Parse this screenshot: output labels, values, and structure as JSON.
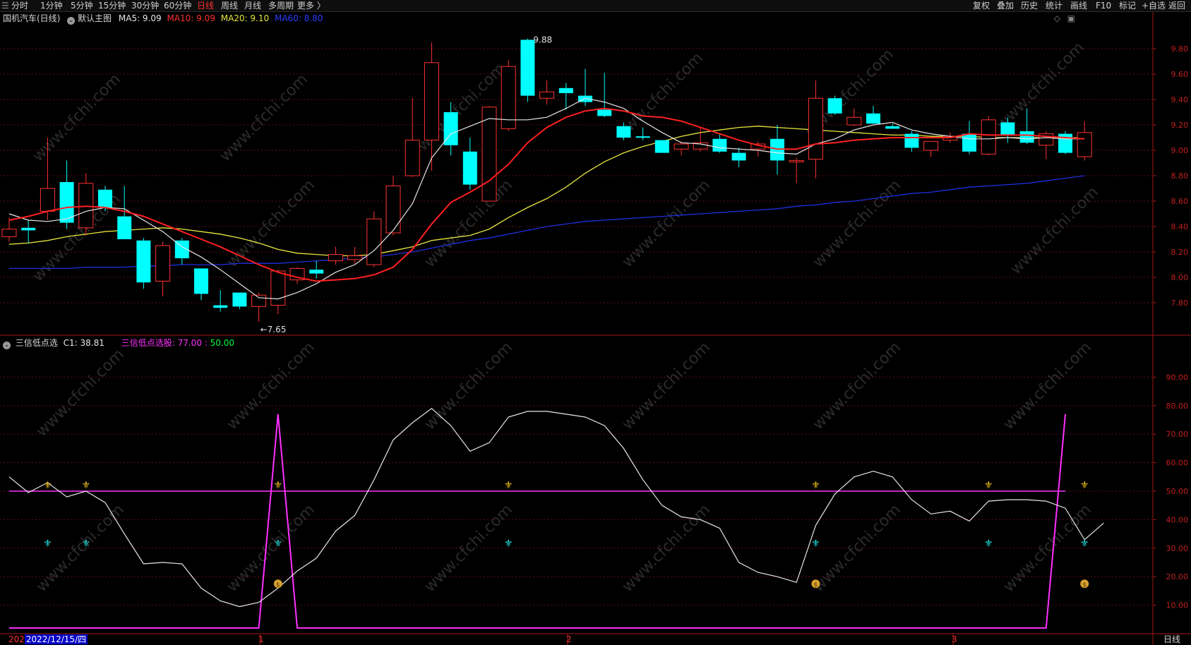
{
  "toolbar": {
    "left_items": [
      "分时",
      "1分钟",
      "5分钟",
      "15分钟",
      "30分钟",
      "60分钟",
      "日线",
      "周线",
      "月线",
      "多周期",
      "更多 〉"
    ],
    "active": "日线",
    "right_items": [
      "复权",
      "叠加",
      "历史",
      "统计",
      "画线",
      "F10",
      "标记",
      "+自选",
      "返回"
    ]
  },
  "main_legend": {
    "stock": "国机汽车(日线)",
    "template": "默认主图",
    "ma5": "MA5: 9.09",
    "ma10": "MA10: 9.09",
    "ma20": "MA20: 9.10",
    "ma60": "MA60: 8.80"
  },
  "sub_legend": {
    "name": "三信低点选",
    "c1": "C1: 38.81",
    "signal_name": "三信低点选股: ",
    "signal_v1": "77.00",
    "signal_sep": " : ",
    "signal_v2": "50.00"
  },
  "bottom": {
    "date_prefix": "202",
    "date_label": "2022/12/15/四",
    "month_1": "1",
    "month_2": "2",
    "month_3": "3",
    "period": "日线"
  },
  "annotations": {
    "high": "9.88",
    "low": "←7.65"
  },
  "watermark": "www.cfchi.com",
  "colors": {
    "up": "#ff3232",
    "down": "#00ffff",
    "ma5": "#e6e6e6",
    "ma10": "#ff2020",
    "ma20": "#e6e640",
    "ma60": "#1f2fe0",
    "sub_line": "#ff30ff",
    "c1": "#e6e6e6"
  },
  "chart_data": [
    {
      "type": "candlestick",
      "ylim": [
        7.55,
        10.05
      ],
      "yticks": [
        "9.80",
        "9.60",
        "9.40",
        "9.20",
        "9.00",
        "8.80",
        "8.60",
        "8.40",
        "8.20",
        "8.00",
        "7.80"
      ],
      "candles": [
        {
          "o": 8.32,
          "h": 8.47,
          "l": 8.28,
          "c": 8.38
        },
        {
          "o": 8.39,
          "h": 8.45,
          "l": 8.27,
          "c": 8.37
        },
        {
          "o": 8.52,
          "h": 9.1,
          "l": 8.45,
          "c": 8.7
        },
        {
          "o": 8.75,
          "h": 8.92,
          "l": 8.38,
          "c": 8.43
        },
        {
          "o": 8.39,
          "h": 8.82,
          "l": 8.33,
          "c": 8.74
        },
        {
          "o": 8.69,
          "h": 8.72,
          "l": 8.52,
          "c": 8.55
        },
        {
          "o": 8.48,
          "h": 8.72,
          "l": 8.32,
          "c": 8.3
        },
        {
          "o": 8.29,
          "h": 8.31,
          "l": 7.91,
          "c": 7.96
        },
        {
          "o": 7.97,
          "h": 8.28,
          "l": 7.85,
          "c": 8.25
        },
        {
          "o": 8.29,
          "h": 8.31,
          "l": 8.1,
          "c": 8.15
        },
        {
          "o": 8.07,
          "h": 8.07,
          "l": 7.82,
          "c": 7.87
        },
        {
          "o": 7.78,
          "h": 7.9,
          "l": 7.73,
          "c": 7.76
        },
        {
          "o": 7.88,
          "h": 7.88,
          "l": 7.75,
          "c": 7.77
        },
        {
          "o": 7.77,
          "h": 7.88,
          "l": 7.65,
          "c": 7.86
        },
        {
          "o": 7.78,
          "h": 8.06,
          "l": 7.71,
          "c": 8.05
        },
        {
          "o": 7.98,
          "h": 8.08,
          "l": 7.95,
          "c": 8.07
        },
        {
          "o": 8.06,
          "h": 8.13,
          "l": 7.99,
          "c": 8.03
        },
        {
          "o": 8.13,
          "h": 8.24,
          "l": 8.1,
          "c": 8.18
        },
        {
          "o": 8.14,
          "h": 8.24,
          "l": 8.11,
          "c": 8.17
        },
        {
          "o": 8.1,
          "h": 8.52,
          "l": 8.08,
          "c": 8.46
        },
        {
          "o": 8.35,
          "h": 8.8,
          "l": 8.33,
          "c": 8.72
        },
        {
          "o": 8.8,
          "h": 9.41,
          "l": 8.79,
          "c": 9.08
        },
        {
          "o": 9.08,
          "h": 9.85,
          "l": 8.84,
          "c": 9.69
        },
        {
          "o": 9.3,
          "h": 9.38,
          "l": 8.96,
          "c": 9.04
        },
        {
          "o": 8.99,
          "h": 9.1,
          "l": 8.69,
          "c": 8.73
        },
        {
          "o": 8.6,
          "h": 9.35,
          "l": 8.6,
          "c": 9.34
        },
        {
          "o": 9.17,
          "h": 9.71,
          "l": 9.15,
          "c": 9.66
        },
        {
          "o": 9.87,
          "h": 9.88,
          "l": 9.38,
          "c": 9.43
        },
        {
          "o": 9.41,
          "h": 9.55,
          "l": 9.36,
          "c": 9.46
        },
        {
          "o": 9.49,
          "h": 9.53,
          "l": 9.32,
          "c": 9.45
        },
        {
          "o": 9.43,
          "h": 9.64,
          "l": 9.35,
          "c": 9.38
        },
        {
          "o": 9.32,
          "h": 9.61,
          "l": 9.26,
          "c": 9.27
        },
        {
          "o": 9.19,
          "h": 9.22,
          "l": 9.08,
          "c": 9.1
        },
        {
          "o": 9.11,
          "h": 9.18,
          "l": 9.08,
          "c": 9.1
        },
        {
          "o": 9.08,
          "h": 9.08,
          "l": 8.98,
          "c": 8.98
        },
        {
          "o": 9.01,
          "h": 9.07,
          "l": 8.96,
          "c": 9.05
        },
        {
          "o": 9.01,
          "h": 9.18,
          "l": 8.99,
          "c": 9.06
        },
        {
          "o": 9.09,
          "h": 9.13,
          "l": 8.98,
          "c": 8.99
        },
        {
          "o": 8.98,
          "h": 9.02,
          "l": 8.87,
          "c": 8.92
        },
        {
          "o": 9.01,
          "h": 9.07,
          "l": 8.95,
          "c": 9.05
        },
        {
          "o": 9.09,
          "h": 9.2,
          "l": 8.81,
          "c": 8.92
        },
        {
          "o": 8.92,
          "h": 8.94,
          "l": 8.74,
          "c": 8.92
        },
        {
          "o": 8.93,
          "h": 9.55,
          "l": 8.78,
          "c": 9.41
        },
        {
          "o": 9.41,
          "h": 9.43,
          "l": 9.28,
          "c": 9.29
        },
        {
          "o": 9.2,
          "h": 9.33,
          "l": 9.19,
          "c": 9.26
        },
        {
          "o": 9.29,
          "h": 9.35,
          "l": 9.21,
          "c": 9.21
        },
        {
          "o": 9.19,
          "h": 9.21,
          "l": 9.17,
          "c": 9.17
        },
        {
          "o": 9.13,
          "h": 9.15,
          "l": 8.99,
          "c": 9.02
        },
        {
          "o": 9.0,
          "h": 9.06,
          "l": 8.95,
          "c": 9.07
        },
        {
          "o": 9.08,
          "h": 9.14,
          "l": 9.06,
          "c": 9.11
        },
        {
          "o": 9.13,
          "h": 9.23,
          "l": 8.97,
          "c": 8.99
        },
        {
          "o": 8.97,
          "h": 9.27,
          "l": 8.96,
          "c": 9.24
        },
        {
          "o": 9.22,
          "h": 9.26,
          "l": 9.06,
          "c": 9.12
        },
        {
          "o": 9.15,
          "h": 9.33,
          "l": 9.05,
          "c": 9.06
        },
        {
          "o": 9.04,
          "h": 9.15,
          "l": 8.93,
          "c": 9.13
        },
        {
          "o": 9.13,
          "h": 9.15,
          "l": 8.97,
          "c": 8.98
        },
        {
          "o": 8.95,
          "h": 9.23,
          "l": 8.92,
          "c": 9.14
        }
      ],
      "ma5": [
        8.5,
        8.45,
        8.44,
        8.46,
        8.52,
        8.55,
        8.54,
        8.45,
        8.36,
        8.24,
        8.16,
        8.06,
        7.95,
        7.84,
        7.83,
        7.88,
        7.95,
        8.04,
        8.1,
        8.21,
        8.37,
        8.58,
        8.94,
        9.13,
        9.19,
        9.25,
        9.24,
        9.24,
        9.26,
        9.33,
        9.41,
        9.38,
        9.33,
        9.23,
        9.14,
        9.06,
        9.05,
        9.02,
        9.01,
        9.0,
        8.98,
        8.97,
        9.05,
        9.09,
        9.16,
        9.2,
        9.22,
        9.16,
        9.13,
        9.11,
        9.09,
        9.09,
        9.1,
        9.09,
        9.1,
        9.09,
        9.09
      ],
      "ma10": [
        8.45,
        8.48,
        8.52,
        8.55,
        8.56,
        8.55,
        8.52,
        8.48,
        8.42,
        8.36,
        8.3,
        8.24,
        8.17,
        8.1,
        8.04,
        8.0,
        7.97,
        7.98,
        7.99,
        8.02,
        8.08,
        8.22,
        8.42,
        8.59,
        8.67,
        8.76,
        8.89,
        9.06,
        9.18,
        9.26,
        9.31,
        9.33,
        9.31,
        9.27,
        9.26,
        9.23,
        9.18,
        9.13,
        9.08,
        9.04,
        9.01,
        9.01,
        9.05,
        9.06,
        9.08,
        9.09,
        9.1,
        9.1,
        9.1,
        9.1,
        9.13,
        9.12,
        9.12,
        9.12,
        9.11,
        9.1,
        9.09
      ],
      "ma20": [
        8.26,
        8.27,
        8.29,
        8.32,
        8.34,
        8.36,
        8.37,
        8.38,
        8.39,
        8.38,
        8.36,
        8.34,
        8.31,
        8.27,
        8.22,
        8.19,
        8.18,
        8.17,
        8.17,
        8.18,
        8.21,
        8.24,
        8.29,
        8.31,
        8.33,
        8.38,
        8.47,
        8.55,
        8.62,
        8.71,
        8.82,
        8.91,
        8.98,
        9.03,
        9.07,
        9.11,
        9.14,
        9.16,
        9.18,
        9.19,
        9.18,
        9.17,
        9.16,
        9.15,
        9.14,
        9.13,
        9.12,
        9.12,
        9.11,
        9.11,
        9.11,
        9.1,
        9.1,
        9.1,
        9.1,
        9.1,
        9.1
      ],
      "ma60": [
        8.07,
        8.07,
        8.07,
        8.07,
        8.08,
        8.08,
        8.08,
        8.09,
        8.09,
        8.1,
        8.1,
        8.1,
        8.11,
        8.11,
        8.11,
        8.12,
        8.13,
        8.14,
        8.15,
        8.16,
        8.18,
        8.2,
        8.23,
        8.26,
        8.29,
        8.31,
        8.34,
        8.37,
        8.4,
        8.42,
        8.44,
        8.45,
        8.46,
        8.47,
        8.48,
        8.49,
        8.5,
        8.51,
        8.52,
        8.53,
        8.54,
        8.56,
        8.57,
        8.59,
        8.6,
        8.62,
        8.64,
        8.66,
        8.67,
        8.69,
        8.71,
        8.72,
        8.73,
        8.74,
        8.76,
        8.78,
        8.8
      ]
    },
    {
      "type": "line",
      "ylim": [
        0,
        100
      ],
      "yticks": [
        "90.00",
        "80.00",
        "70.00",
        "60.00",
        "50.00",
        "40.00",
        "30.00",
        "20.00",
        "10.00"
      ],
      "series": [
        {
          "name": "C1",
          "values": [
            55,
            49.5,
            53,
            48,
            50,
            46,
            35,
            24.5,
            25,
            24.5,
            16,
            11.5,
            9.5,
            11,
            16,
            22,
            26.5,
            36,
            41.5,
            54,
            68,
            74,
            79,
            73,
            64,
            67,
            76,
            78,
            78,
            77,
            76,
            73,
            65,
            54,
            45,
            41,
            40,
            37,
            25,
            21.5,
            20,
            18,
            38,
            49,
            55,
            57,
            55,
            47,
            42,
            43,
            39.5,
            46.5,
            47,
            47,
            46.5,
            44,
            33,
            38.81
          ]
        },
        {
          "name": "三信低点选股",
          "values": [
            0,
            0,
            0,
            0,
            0,
            0,
            0,
            0,
            0,
            0,
            0,
            0,
            0,
            0,
            77,
            0,
            0,
            0,
            0,
            0,
            0,
            0,
            0,
            0,
            0,
            0,
            0,
            0,
            0,
            0,
            0,
            0,
            0,
            0,
            0,
            0,
            0,
            0,
            0,
            0,
            0,
            0,
            0,
            0,
            0,
            0,
            0,
            0,
            0,
            0,
            0,
            0,
            0,
            0,
            0,
            77
          ]
        }
      ],
      "reference_line": 50,
      "signals": [
        {
          "index": 2,
          "gold": true,
          "cyan": true,
          "bag": false
        },
        {
          "index": 4,
          "gold": true,
          "cyan": true,
          "bag": false
        },
        {
          "index": 14,
          "gold": true,
          "cyan": true,
          "bag": true
        },
        {
          "index": 26,
          "gold": true,
          "cyan": true,
          "bag": false
        },
        {
          "index": 42,
          "gold": true,
          "cyan": true,
          "bag": true
        },
        {
          "index": 51,
          "gold": true,
          "cyan": true,
          "bag": false
        },
        {
          "index": 56,
          "gold": true,
          "cyan": true,
          "bag": true
        }
      ]
    }
  ]
}
